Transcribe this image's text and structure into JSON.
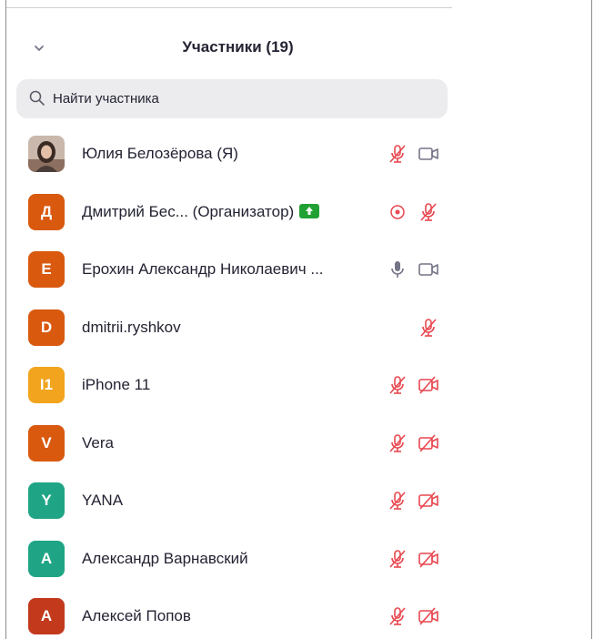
{
  "panel": {
    "title": "Участники (19)",
    "search_placeholder": "Найти участника"
  },
  "icons": {
    "collapse": "chevron-down-icon",
    "search": "search-icon",
    "mic_muted": "mic-muted-icon",
    "mic_on": "mic-icon",
    "video_on": "video-camera-icon",
    "video_off": "video-off-icon",
    "recording": "recording-icon",
    "share": "screen-share-icon"
  },
  "colors": {
    "muted_red": "#e8474f",
    "icon_gray": "#747487",
    "share_green": "#21a133",
    "search_bg": "#ececee"
  },
  "participants": [
    {
      "name": "Юлия Белозёрова (Я)",
      "avatar_type": "photo",
      "mic": "muted",
      "video": "on"
    },
    {
      "name": "Дмитрий Бес...  (Организатор)",
      "avatar_letter": "Д",
      "avatar_color": "#d9590f",
      "mic": "muted",
      "video": "none",
      "recording": true,
      "sharing": true
    },
    {
      "name": "Ерохин Александр Николаевич ...",
      "avatar_letter": "Е",
      "avatar_color": "#d9590f",
      "mic": "on",
      "video": "on"
    },
    {
      "name": "dmitrii.ryshkov",
      "avatar_letter": "D",
      "avatar_color": "#d9590f",
      "mic": "muted",
      "video": "none"
    },
    {
      "name": "iPhone 11",
      "avatar_letter": "I1",
      "avatar_color": "#f2a41e",
      "mic": "muted",
      "video": "off"
    },
    {
      "name": "Vera",
      "avatar_letter": "V",
      "avatar_color": "#d9590f",
      "mic": "muted",
      "video": "off"
    },
    {
      "name": "YANA",
      "avatar_letter": "Y",
      "avatar_color": "#1fa585",
      "mic": "muted",
      "video": "off"
    },
    {
      "name": "Александр Варнавский",
      "avatar_letter": "А",
      "avatar_color": "#1fa585",
      "mic": "muted",
      "video": "off"
    },
    {
      "name": "Алексей Попов",
      "avatar_letter": "А",
      "avatar_color": "#c2391c",
      "mic": "muted",
      "video": "off"
    }
  ]
}
